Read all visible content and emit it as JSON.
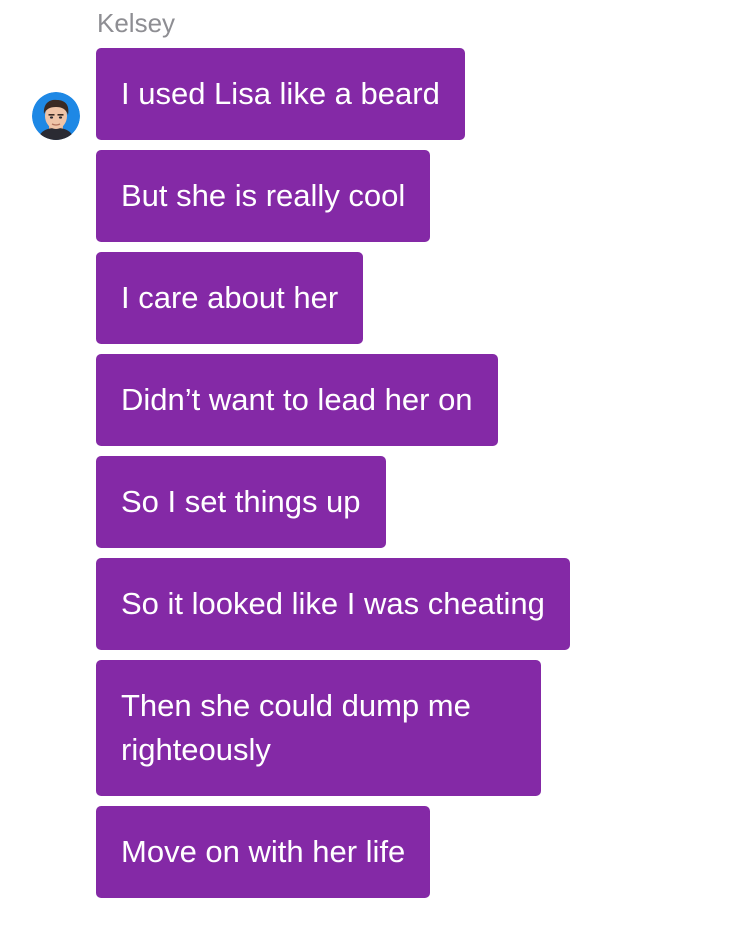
{
  "conversation": {
    "sender_name": "Kelsey",
    "avatar_icon": "person-avatar-icon",
    "bubble_color": "#8429a6",
    "messages": [
      "I used Lisa like a beard",
      "But she is really cool",
      "I care about her",
      "Didn’t want to lead her on",
      "So I set things up",
      "So it looked like I was cheating",
      "Then she could dump me righteously",
      "Move on with her life"
    ]
  }
}
